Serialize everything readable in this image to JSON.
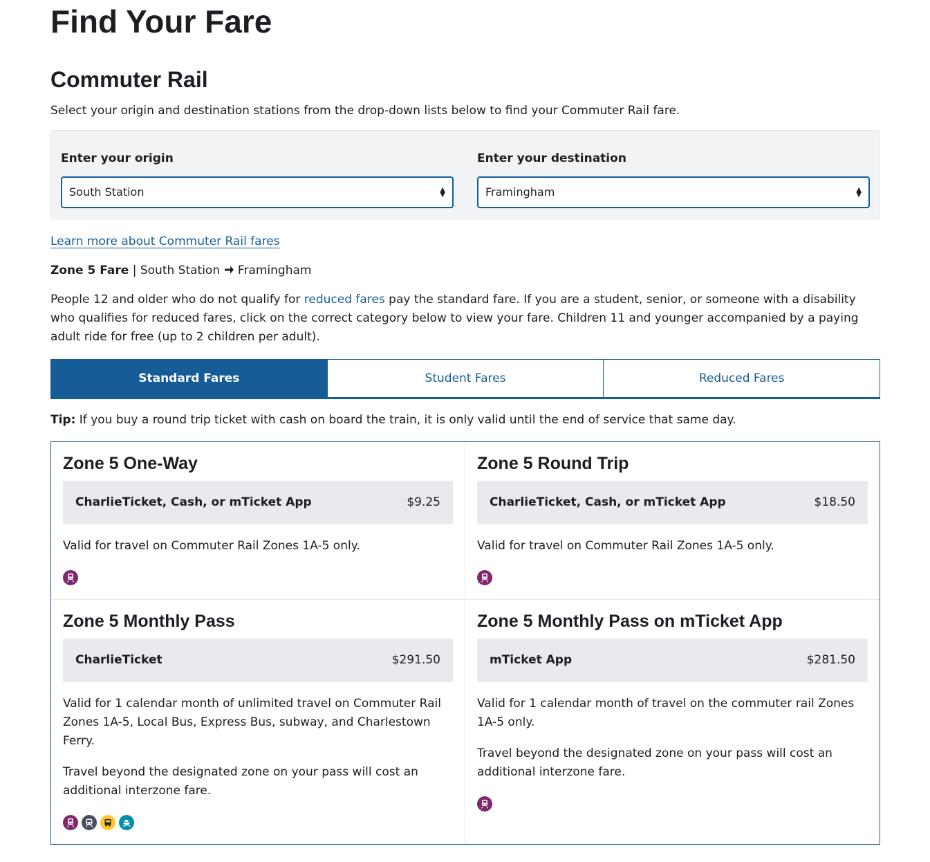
{
  "page": {
    "title": "Find Your Fare",
    "section_title": "Commuter Rail",
    "lead": "Select your origin and destination stations from the drop-down lists below to find your Commuter Rail fare."
  },
  "picker": {
    "origin_label": "Enter your origin",
    "origin_value": "South Station",
    "destination_label": "Enter your destination",
    "destination_value": "Framingham"
  },
  "learn_link": "Learn more about Commuter Rail fares",
  "zone_summary": {
    "zone": "Zone 5 Fare",
    "separator": "|",
    "from": "South Station",
    "to": "Framingham"
  },
  "intro": {
    "before_link": "People 12 and older who do not qualify for ",
    "link": "reduced fares",
    "after_link": " pay the standard fare. If you are a student, senior, or someone with a disability who qualifies for reduced fares, click on the correct category below to view your fare. Children 11 and younger accompanied by a paying adult ride for free (up to 2 children per adult)."
  },
  "tabs": [
    {
      "label": "Standard Fares",
      "active": true
    },
    {
      "label": "Student Fares",
      "active": false
    },
    {
      "label": "Reduced Fares",
      "active": false
    }
  ],
  "tip": {
    "label": "Tip:",
    "text": " If you buy a round trip ticket with cash on board the train, it is only valid until the end of service that same day."
  },
  "fares": [
    {
      "title": "Zone 5 One-Way",
      "media": "CharlieTicket, Cash, or mTicket App",
      "price": "$9.25",
      "notes": [
        "Valid for travel on Commuter Rail Zones 1A-5 only."
      ],
      "modes": [
        "commuter-rail-icon"
      ]
    },
    {
      "title": "Zone 5 Round Trip",
      "media": "CharlieTicket, Cash, or mTicket App",
      "price": "$18.50",
      "notes": [
        "Valid for travel on Commuter Rail Zones 1A-5 only."
      ],
      "modes": [
        "commuter-rail-icon"
      ]
    },
    {
      "title": "Zone 5 Monthly Pass",
      "media": "CharlieTicket",
      "price": "$291.50",
      "notes": [
        "Valid for 1 calendar month of unlimited travel on Commuter Rail Zones 1A-5, Local Bus, Express Bus, subway, and Charlestown Ferry.",
        "Travel beyond the designated zone on your pass will cost an additional interzone fare."
      ],
      "modes": [
        "commuter-rail-icon",
        "subway-icon",
        "bus-icon",
        "ferry-icon"
      ]
    },
    {
      "title": "Zone 5 Monthly Pass on mTicket App",
      "media": "mTicket App",
      "price": "$281.50",
      "notes": [
        "Valid for 1 calendar month of travel on the commuter rail Zones 1A-5 only.",
        "Travel beyond the designated zone on your pass will cost an additional interzone fare."
      ],
      "modes": [
        "commuter-rail-icon"
      ]
    }
  ],
  "colors": {
    "brand_blue": "#165c96",
    "commuter_rail": "#80276c",
    "subway": "#494f5c",
    "bus": "#ffc72c",
    "ferry": "#008eaa"
  }
}
